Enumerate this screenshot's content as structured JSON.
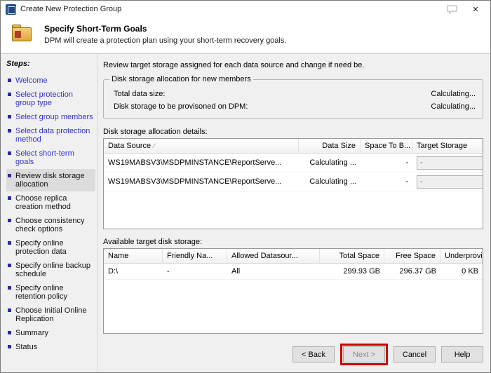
{
  "window": {
    "title": "Create New Protection Group"
  },
  "icons": {
    "close": "✕",
    "sort": "∕",
    "dropdown": "▾"
  },
  "header": {
    "title": "Specify Short-Term Goals",
    "subtitle": "DPM will create a protection plan using your short-term recovery goals."
  },
  "sidebar": {
    "title": "Steps:",
    "items": [
      {
        "label": "Welcome",
        "state": "done"
      },
      {
        "label": "Select protection group type",
        "state": "done"
      },
      {
        "label": "Select group members",
        "state": "done"
      },
      {
        "label": "Select data protection method",
        "state": "done"
      },
      {
        "label": "Select short-term goals",
        "state": "done"
      },
      {
        "label": "Review disk storage allocation",
        "state": "current"
      },
      {
        "label": "Choose replica creation method",
        "state": "todo"
      },
      {
        "label": "Choose consistency check options",
        "state": "todo"
      },
      {
        "label": "Specify online protection data",
        "state": "todo"
      },
      {
        "label": "Specify online backup schedule",
        "state": "todo"
      },
      {
        "label": "Specify online retention policy",
        "state": "todo"
      },
      {
        "label": "Choose Initial Online Replication",
        "state": "todo"
      },
      {
        "label": "Summary",
        "state": "todo"
      },
      {
        "label": "Status",
        "state": "todo"
      }
    ]
  },
  "main": {
    "intro": "Review target storage assigned for each data source and change if need be.",
    "allocation": {
      "legend": "Disk storage allocation for new members",
      "rows": [
        {
          "label": "Total data size:",
          "value": "Calculating..."
        },
        {
          "label": "Disk storage to be provisoned on DPM:",
          "value": "Calculating..."
        }
      ]
    },
    "details": {
      "label": "Disk storage allocation details:",
      "columns": [
        "Data Source",
        "Data Size",
        "Space To B...",
        "Target Storage"
      ],
      "rows": [
        {
          "source": "WS19MABSV3\\MSDPMINSTANCE\\ReportServe...",
          "size": "Calculating ...",
          "space": "-",
          "target": "-"
        },
        {
          "source": "WS19MABSV3\\MSDPMINSTANCE\\ReportServe...",
          "size": "Calculating ...",
          "space": "-",
          "target": "-"
        }
      ]
    },
    "storage": {
      "label": "Available target disk storage:",
      "columns": [
        "Name",
        "Friendly Na...",
        "Allowed Datasour...",
        "Total Space",
        "Free Space",
        "Underprovi..."
      ],
      "rows": [
        {
          "name": "D:\\",
          "friendly": "-",
          "allowed": "All",
          "total": "299.93 GB",
          "free": "296.37 GB",
          "under": "0 KB"
        }
      ]
    }
  },
  "footer": {
    "back": "< Back",
    "next": "Next >",
    "cancel": "Cancel",
    "help": "Help"
  }
}
